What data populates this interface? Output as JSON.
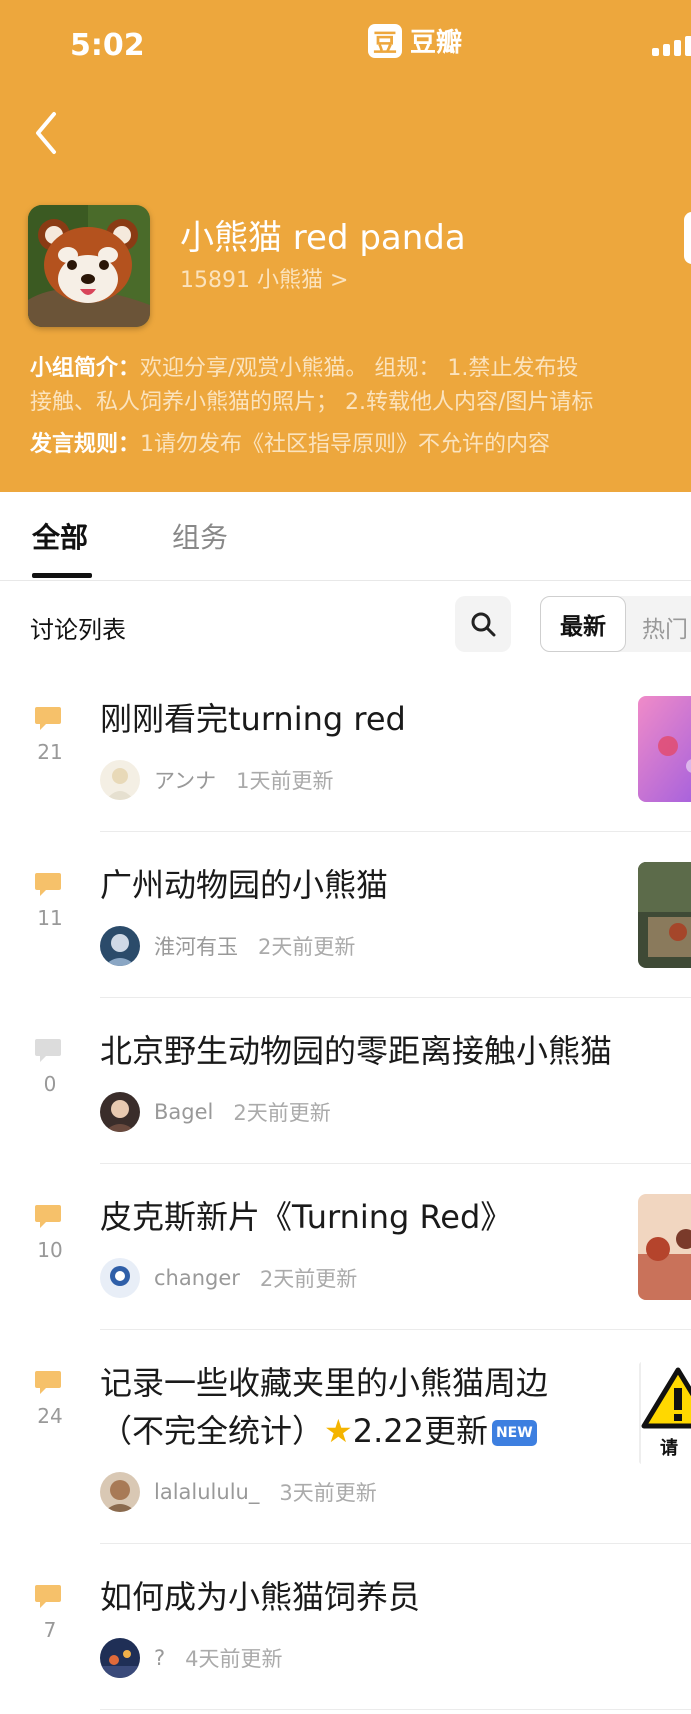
{
  "status_bar": {
    "time": "5:02"
  },
  "app": {
    "badge": "豆",
    "name": "豆瓣"
  },
  "group": {
    "name": "小熊猫 red panda",
    "member_line": "15891 小熊猫 >",
    "intro_label": "小组简介：",
    "intro_line1": "欢迎分享/观赏小熊猫。 组规： 1.禁止发布投",
    "intro_line2": "接触、私人饲养小熊猫的照片； 2.转载他人内容/图片请标",
    "rules_label": "发言规则：",
    "rules_text": "1请勿发布《社区指导原则》不允许的内容"
  },
  "tabs": [
    {
      "label": "全部"
    },
    {
      "label": "组务"
    }
  ],
  "list": {
    "title": "讨论列表",
    "sort_new": "最新",
    "sort_hot": "热门"
  },
  "posts": [
    {
      "title": "刚刚看完turning red",
      "comments": "21",
      "user": "アンナ",
      "updated": "1天前更新",
      "active": true,
      "has_thumb": true
    },
    {
      "title": "广州动物园的小熊猫",
      "comments": "11",
      "user": "淮河有玉",
      "updated": "2天前更新",
      "active": true,
      "has_thumb": true
    },
    {
      "title": "北京野生动物园的零距离接触小熊猫",
      "comments": "0",
      "user": "Bagel",
      "updated": "2天前更新",
      "active": false,
      "has_thumb": false
    },
    {
      "title": "皮克斯新片《Turning Red》",
      "comments": "10",
      "user": "changer",
      "updated": "2天前更新",
      "active": true,
      "has_thumb": true
    },
    {
      "title_line1": "记录一些收藏夹里的小熊猫周边",
      "title_line2_prefix": "（不完全统计）",
      "title_line2_suffix": "2.22更新",
      "new_badge": "NEW",
      "comments": "24",
      "user": "lalalululu_",
      "updated": "3天前更新",
      "active": true,
      "has_thumb": true,
      "thumb_text": "请"
    },
    {
      "title": "如何成为小熊猫饲养员",
      "comments": "7",
      "user": "?",
      "updated": "4天前更新",
      "active": true,
      "has_thumb": false
    }
  ],
  "colors": {
    "header": "#eda73d",
    "comment_active": "#f6c16a",
    "comment_inactive": "#dcdcdc"
  }
}
